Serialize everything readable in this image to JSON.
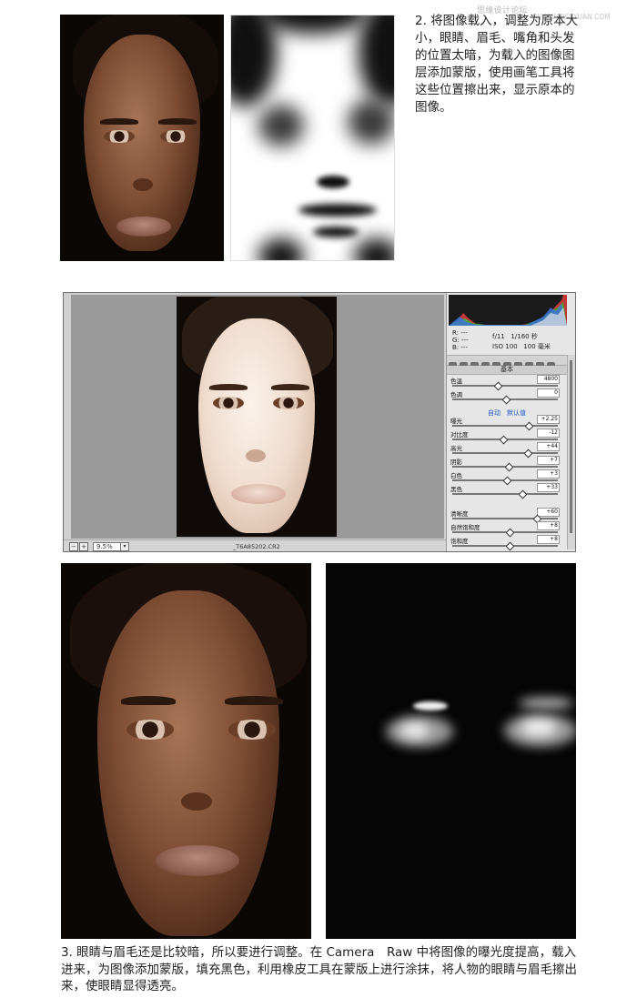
{
  "watermark": {
    "site_name": "思缘设计论坛",
    "site_url": "WWW.MISSYUAN.COM"
  },
  "step2": {
    "text": "2. 将图像载入，调整为原本大小，眼睛、眉毛、嘴角和头发的位置太暗，为载入的图像图层添加蒙版，使用画笔工具将这些位置擦出来，显示原本的图像。"
  },
  "camera_raw": {
    "zoom_value": "9.5%",
    "filename": "_T6A85202.CR2",
    "readout": {
      "r_label": "R:",
      "g_label": "G:",
      "b_label": "B:",
      "r_value": "---",
      "g_value": "---",
      "b_value": "---",
      "aperture": "f/11",
      "shutter": "1/160 秒",
      "iso": "ISO 100",
      "focal": "100 毫米"
    },
    "panel_title": "基本",
    "auto_link": "自动",
    "default_link": "默认值",
    "sliders": [
      {
        "label": "色温",
        "value": "4800",
        "pos": 0.42
      },
      {
        "label": "色调",
        "value": "0",
        "pos": 0.5
      },
      {
        "label": "曝光",
        "value": "+2.25",
        "pos": 0.72
      },
      {
        "label": "对比度",
        "value": "-12",
        "pos": 0.47
      },
      {
        "label": "高光",
        "value": "+44",
        "pos": 0.71
      },
      {
        "label": "阴影",
        "value": "+7",
        "pos": 0.53
      },
      {
        "label": "白色",
        "value": "+3",
        "pos": 0.51
      },
      {
        "label": "黑色",
        "value": "+33",
        "pos": 0.66
      },
      {
        "label": "清晰度",
        "value": "+60",
        "pos": 0.8
      },
      {
        "label": "自然饱和度",
        "value": "+8",
        "pos": 0.54
      },
      {
        "label": "饱和度",
        "value": "+8",
        "pos": 0.54
      }
    ]
  },
  "step3": {
    "text": "3. 眼睛与眉毛还是比较暗，所以要进行调整。在 Camera　Raw 中将图像的曝光度提高，载入进来，为图像添加蒙版，填充黑色，利用橡皮工具在蒙版上进行涂抹，将人物的眼睛与眉毛擦出来，使眼睛显得透亮。"
  }
}
